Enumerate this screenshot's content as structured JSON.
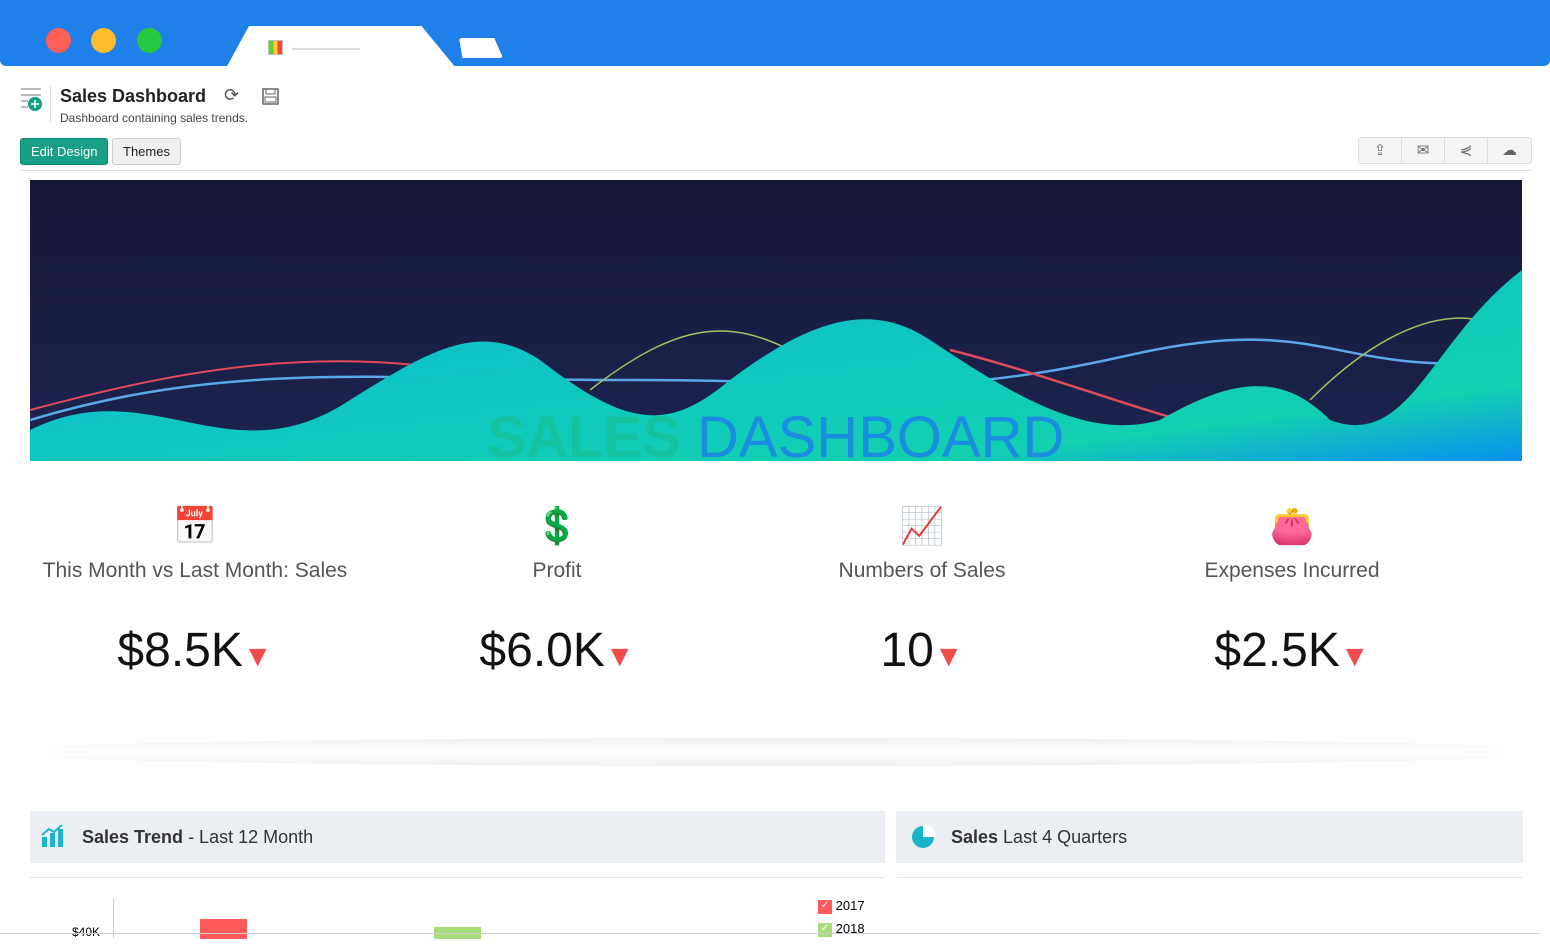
{
  "header": {
    "title": "Sales Dashboard",
    "subtitle": "Dashboard containing sales trends.",
    "edit_label": "Edit Design",
    "themes_label": "Themes"
  },
  "banner": {
    "word1": "SALES",
    "word2": "DASHBOARD"
  },
  "kpis": [
    {
      "label": "This Month vs Last Month: Sales",
      "value": "$8.5K",
      "trend": "down"
    },
    {
      "label": "Profit",
      "value": "$6.0K",
      "trend": "down"
    },
    {
      "label": "Numbers of Sales",
      "value": "10",
      "trend": "down"
    },
    {
      "label": "Expenses Incurred",
      "value": "$2.5K",
      "trend": "down"
    }
  ],
  "panels": {
    "trend_bold": "Sales Trend",
    "trend_rest": " - Last 12 Month",
    "quarters_bold": "Sales",
    "quarters_rest": " Last 4 Quarters"
  },
  "chart_data": {
    "type": "bar",
    "ytick": "$40K",
    "legend": [
      "2017",
      "2018"
    ],
    "colors": {
      "2017": "#ff5a5a",
      "2018": "#a9dd7a"
    }
  }
}
